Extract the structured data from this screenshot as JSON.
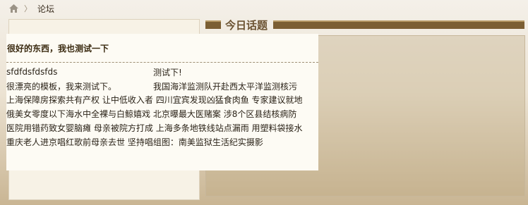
{
  "breadcrumb": {
    "home_icon": "home-icon",
    "separator": "〉",
    "current": "论坛"
  },
  "section": {
    "title": "今日话题"
  },
  "featured_topic": "很好的东西，我也测试一下",
  "topics": [
    {
      "left": "sfdfdsfdsfds",
      "right": "测试下!"
    },
    {
      "left": "很漂亮的模板，我来测试下。",
      "right": "我国海洋监测队开赴西太平洋监测核污"
    }
  ],
  "news_lines": [
    [
      "上海保障房探索共有产权",
      "让中低收入者",
      "四川宜宾发现凶猛食肉鱼",
      "专家建议就地"
    ],
    [
      "俄美女零度以下海水中全裸与白鲸嬉戏",
      "北京曝最大医赌案",
      "涉8个区县结核病防"
    ],
    [
      "医院用错药致女婴脑瘫",
      "母亲被院方打成",
      "上海多条地铁线站点漏雨",
      "用塑料袋接水"
    ],
    [
      "重庆老人进京唱红歌前母亲去世",
      "坚持唱组图：南美监狱生活纪实摄影"
    ]
  ],
  "colors": {
    "header_bar": "#7b5e33",
    "title": "#6b5231",
    "panel_bg": "#f7f2e6"
  }
}
